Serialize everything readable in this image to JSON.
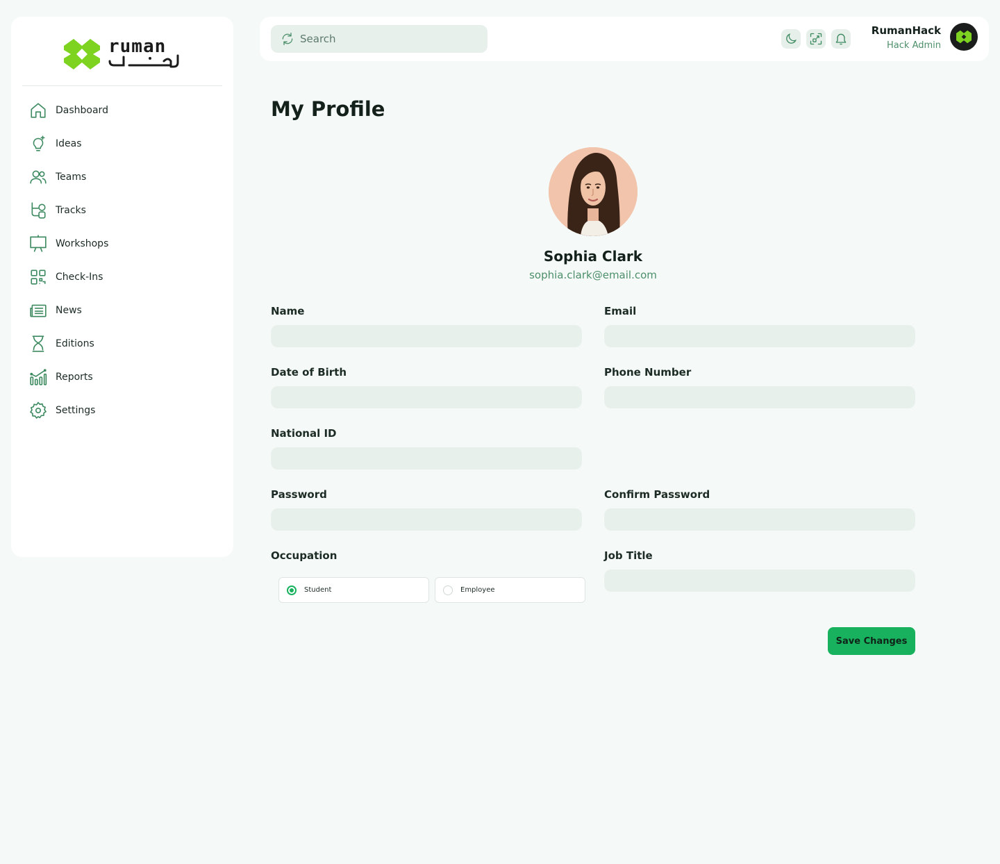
{
  "brand": {
    "name": "ruman",
    "accent": "#7ed321",
    "primary": "#18b25f"
  },
  "sidebar": {
    "items": [
      {
        "label": "Dashboard",
        "icon": "home-icon"
      },
      {
        "label": "Ideas",
        "icon": "lightbulb-icon"
      },
      {
        "label": "Teams",
        "icon": "users-icon"
      },
      {
        "label": "Tracks",
        "icon": "route-icon"
      },
      {
        "label": "Workshops",
        "icon": "presentation-icon"
      },
      {
        "label": "Check-Ins",
        "icon": "qr-code-icon"
      },
      {
        "label": "News",
        "icon": "newspaper-icon"
      },
      {
        "label": "Editions",
        "icon": "trophy-icon"
      },
      {
        "label": "Reports",
        "icon": "bar-chart-icon"
      },
      {
        "label": "Settings",
        "icon": "gear-icon"
      }
    ]
  },
  "header": {
    "search_placeholder": "Search",
    "user": {
      "name": "RumanHack",
      "role": "Hack Admin"
    }
  },
  "page": {
    "title": "My Profile"
  },
  "profile": {
    "name": "Sophia Clark",
    "email": "sophia.clark@email.com"
  },
  "form": {
    "name": {
      "label": "Name",
      "value": ""
    },
    "email": {
      "label": "Email",
      "value": ""
    },
    "dob": {
      "label": "Date of Birth",
      "value": ""
    },
    "phone": {
      "label": "Phone Number",
      "value": ""
    },
    "national_id": {
      "label": "National ID",
      "value": ""
    },
    "password": {
      "label": "Password",
      "value": ""
    },
    "confirm_password": {
      "label": "Confirm Password",
      "value": ""
    },
    "occupation": {
      "label": "Occupation",
      "options": [
        "Student",
        "Employee"
      ],
      "selected": "Student"
    },
    "job_title": {
      "label": "Job Title",
      "value": ""
    },
    "save_label": "Save Changes"
  }
}
